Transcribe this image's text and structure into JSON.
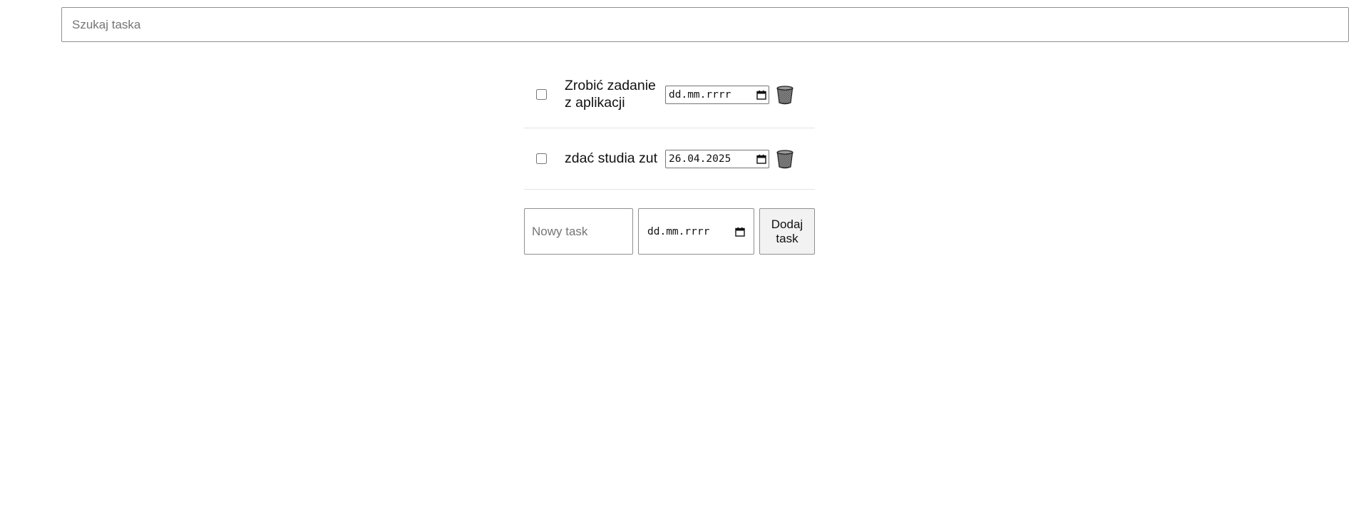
{
  "search": {
    "placeholder": "Szukaj taska",
    "value": ""
  },
  "tasks": [
    {
      "text": "Zrobić zadanie z aplikacji",
      "checked": false,
      "date": "dd.mm.rrrr",
      "delete_icon": "trash-icon"
    },
    {
      "text": "zdać studia zut",
      "checked": false,
      "date": "26.04.2025",
      "delete_icon": "trash-icon"
    }
  ],
  "new_task": {
    "placeholder": "Nowy task",
    "value": "",
    "date_placeholder": "dd.mm.rrrr",
    "add_label": "Dodaj task"
  },
  "icons": {
    "calendar": "calendar-icon",
    "trash": "trash-icon"
  },
  "colors": {
    "border": "#8f8f8f",
    "divider": "#e4e4e4",
    "button_bg": "#f2f2f2",
    "trash_gray": "#8a8a8a"
  }
}
